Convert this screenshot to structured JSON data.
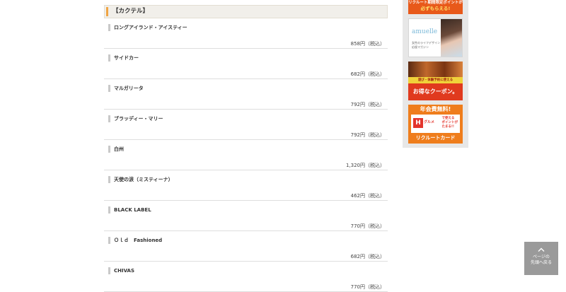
{
  "menu": {
    "category": "【カクテル】",
    "items": [
      {
        "name": "ロングアイランド・アイスティー",
        "price": "858円（税込）"
      },
      {
        "name": "サイドカー",
        "price": "682円（税込）"
      },
      {
        "name": "マルガリータ",
        "price": "792円（税込）"
      },
      {
        "name": "ブラッディー・マリー",
        "price": "792円（税込）"
      },
      {
        "name": "白州",
        "price": "1,320円（税込）"
      },
      {
        "name": "天使の涙（ミスティーナ）",
        "price": "462円（税込）"
      },
      {
        "name": "BLACK LABEL",
        "price": "770円（税込）"
      },
      {
        "name": "Ｏｌｄ　Fashioned",
        "price": "682円（税込）"
      },
      {
        "name": "CHIVAS",
        "price": "770円（税込）"
      }
    ]
  },
  "sidebar": {
    "ad1": {
      "line1": "リクルート期間限定ポイントが",
      "line2": "必ずもらえる!"
    },
    "ad2": {
      "logo": "amuelle",
      "sub1": "女性のライフデザイン",
      "sub2": "応援マガジン"
    },
    "ad3": {
      "strip": "遊び・体験予約に使える",
      "coupon": "お得なクーポン。"
    },
    "ad4": {
      "top": "年会費無料!",
      "hot": "H",
      "gourmet": "グルメ",
      "pts1": "で使える",
      "pts2": "ポイントが",
      "pts3": "たまる!!",
      "bottom": "リクルートカード"
    }
  },
  "back_to_top": {
    "label": "ページの\n先頭へ戻る"
  },
  "colors": {
    "accent": "#f0a443",
    "divider": "#dedede",
    "sidebar_bg": "#e7e7e7",
    "to_top_bg": "#9a9a9a"
  }
}
